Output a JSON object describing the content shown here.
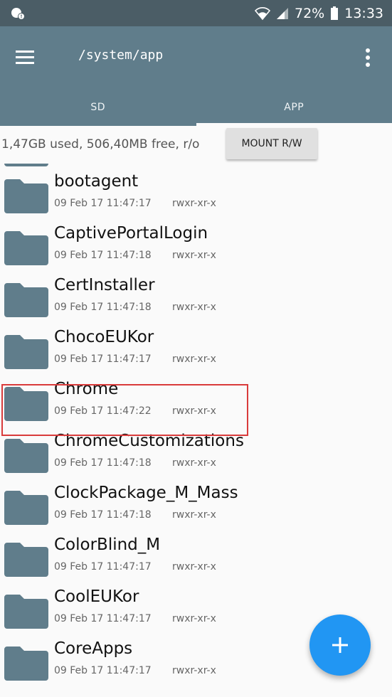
{
  "status_bar": {
    "battery": "72%",
    "time": "13:33"
  },
  "app_bar": {
    "path": "/system/app",
    "tabs": [
      {
        "label": "SD",
        "active": false
      },
      {
        "label": "APP",
        "active": true
      }
    ]
  },
  "info": {
    "storage_text": "1,47GB used, 506,40MB free, r/o",
    "mount_button_label": "MOUNT R/W"
  },
  "colors": {
    "app_bar": "#607d8b",
    "status_bar": "#4b5d66",
    "folder": "#607d8b",
    "fab": "#2196f3",
    "highlight": "#d93b3b"
  },
  "files": [
    {
      "name": "bootagent",
      "date": "09 Feb 17 11:47:17",
      "perms": "rwxr-xr-x"
    },
    {
      "name": "CaptivePortalLogin",
      "date": "09 Feb 17 11:47:18",
      "perms": "rwxr-xr-x"
    },
    {
      "name": "CertInstaller",
      "date": "09 Feb 17 11:47:18",
      "perms": "rwxr-xr-x"
    },
    {
      "name": "ChocoEUKor",
      "date": "09 Feb 17 11:47:17",
      "perms": "rwxr-xr-x"
    },
    {
      "name": "Chrome",
      "date": "09 Feb 17 11:47:22",
      "perms": "rwxr-xr-x",
      "highlighted": true
    },
    {
      "name": "ChromeCustomizations",
      "date": "09 Feb 17 11:47:18",
      "perms": "rwxr-xr-x"
    },
    {
      "name": "ClockPackage_M_Mass",
      "date": "09 Feb 17 11:47:18",
      "perms": "rwxr-xr-x"
    },
    {
      "name": "ColorBlind_M",
      "date": "09 Feb 17 11:47:17",
      "perms": "rwxr-xr-x"
    },
    {
      "name": "CoolEUKor",
      "date": "09 Feb 17 11:47:17",
      "perms": "rwxr-xr-x"
    },
    {
      "name": "CoreApps",
      "date": "09 Feb 17 11:47:17",
      "perms": "rwxr-xr-x"
    }
  ],
  "icons": {
    "menu": "hamburger-menu-icon",
    "overflow": "more-vert-icon",
    "folder": "folder-icon",
    "fab": "plus-icon"
  }
}
